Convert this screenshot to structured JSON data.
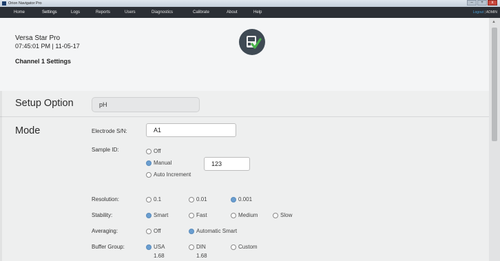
{
  "window": {
    "title": "Orion Navigator Pro",
    "buttons": [
      "–",
      "+",
      "x"
    ]
  },
  "menu": {
    "items": [
      "Home",
      "Settings",
      "Logs",
      "Reports",
      "Users",
      "Diagnostics",
      "Calibrate",
      "About",
      "Help"
    ],
    "active": "Settings",
    "logout_label": "Logout",
    "separator": "|",
    "user_label": "ADMIN"
  },
  "header": {
    "device_name": "Versa Star Pro",
    "datetime": "07:45:01 PM | 11-05-17",
    "channel_title": "Channel 1 Settings",
    "status_icon": "meter-check-icon"
  },
  "setup": {
    "label": "Setup Option",
    "value": "pH"
  },
  "mode": {
    "label": "Mode",
    "electrode_label": "Electrode S/N:",
    "electrode_value": "A1",
    "sample_id_label": "Sample ID:",
    "sample_id_options": [
      "Off",
      "Manual",
      "Auto Increment"
    ],
    "sample_id_selected": "Manual",
    "sample_id_value": "123",
    "resolution_label": "Resolution:",
    "resolution_options": [
      "0.1",
      "0.01",
      "0.001"
    ],
    "resolution_selected": "0.001",
    "stability_label": "Stability:",
    "stability_options": [
      "Smart",
      "Fast",
      "Medium",
      "Slow"
    ],
    "stability_selected": "Smart",
    "averaging_label": "Averaging:",
    "averaging_options": [
      "Off",
      "Automatic Smart"
    ],
    "averaging_selected": "Automatic Smart",
    "buffer_label": "Buffer Group:",
    "buffer_options": [
      "USA",
      "DIN",
      "Custom"
    ],
    "buffer_selected": "USA",
    "buffer_values": [
      "1.68",
      "1.68"
    ]
  },
  "colors": {
    "menubar": "#2b2f35",
    "accent_radio": "#6a9ed0",
    "link": "#4ea3d9",
    "status_check": "#49b54a"
  }
}
